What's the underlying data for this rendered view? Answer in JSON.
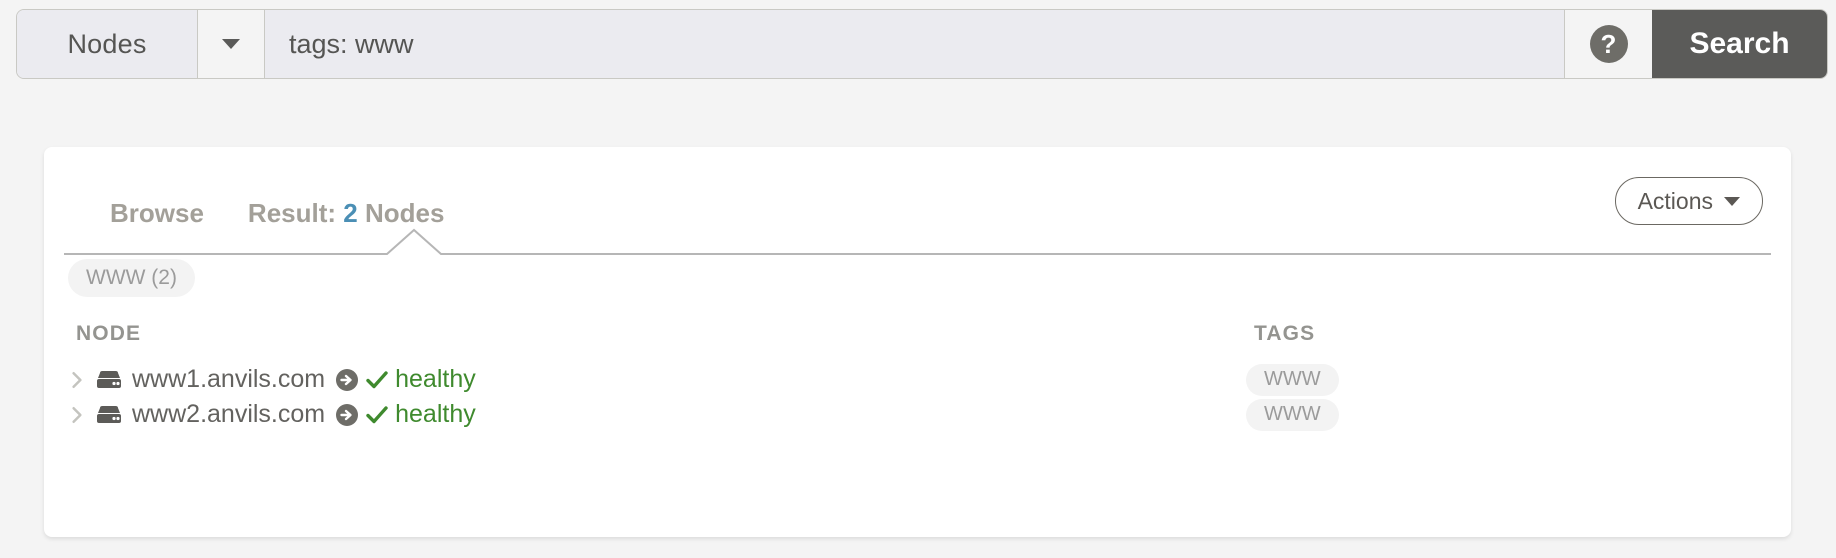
{
  "search": {
    "scope_label": "Nodes",
    "scope_caret_icon": "chevron-down-icon",
    "query_value": "tags: www",
    "query_placeholder": "",
    "help_icon": "question-mark-circle-icon",
    "help_label": "?",
    "search_label": "Search"
  },
  "card": {
    "tabs": [
      {
        "label": "Browse",
        "active": false
      },
      {
        "label_prefix": "Result: ",
        "count": "2",
        "label_suffix": " Nodes",
        "active": true
      }
    ],
    "actions": {
      "label": "Actions",
      "caret_icon": "caret-down-icon"
    },
    "filter_chips": [
      {
        "label": "WWW (2)"
      }
    ],
    "table": {
      "columns": {
        "node": "NODE",
        "tags": "TAGS"
      },
      "rows": [
        {
          "expand_icon": "chevron-right-icon",
          "node_icon": "server-icon",
          "hostname": "www1.anvils.com",
          "goto_icon": "arrow-circle-right-icon",
          "status_icon": "check-icon",
          "status": "healthy",
          "tags": [
            "WWW"
          ]
        },
        {
          "expand_icon": "chevron-right-icon",
          "node_icon": "server-icon",
          "hostname": "www2.anvils.com",
          "goto_icon": "arrow-circle-right-icon",
          "status_icon": "check-icon",
          "status": "healthy",
          "tags": [
            "WWW"
          ]
        }
      ]
    }
  },
  "colors": {
    "accent_blue": "#4b8fb5",
    "status_green": "#3f8a2e",
    "search_button_bg": "#5b5b59",
    "page_bg": "#f4f4f4",
    "chip_bg": "#f3f3f3"
  }
}
